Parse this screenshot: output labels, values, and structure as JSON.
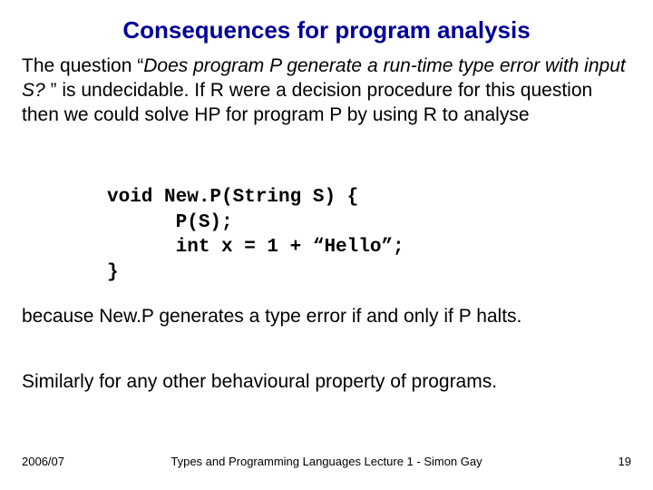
{
  "title": "Consequences for program analysis",
  "para1_a": "The question “",
  "para1_italic": "Does program P generate a run-time type error with input S? ",
  "para1_b": "” is undecidable. If R were a decision procedure for this question then we could solve HP for program P by using R to analyse",
  "code_l1": "void New.P(String S) {",
  "code_l2": "      P(S);",
  "code_l3": "      int x = 1 + “Hello”;",
  "code_l4": "}",
  "para2": "because New.P generates a type error if and only if P halts.",
  "para3": "Similarly for any other behavioural property of programs.",
  "footer": {
    "date": "2006/07",
    "mid": "Types and Programming Languages Lecture 1 - Simon Gay",
    "num": "19"
  }
}
